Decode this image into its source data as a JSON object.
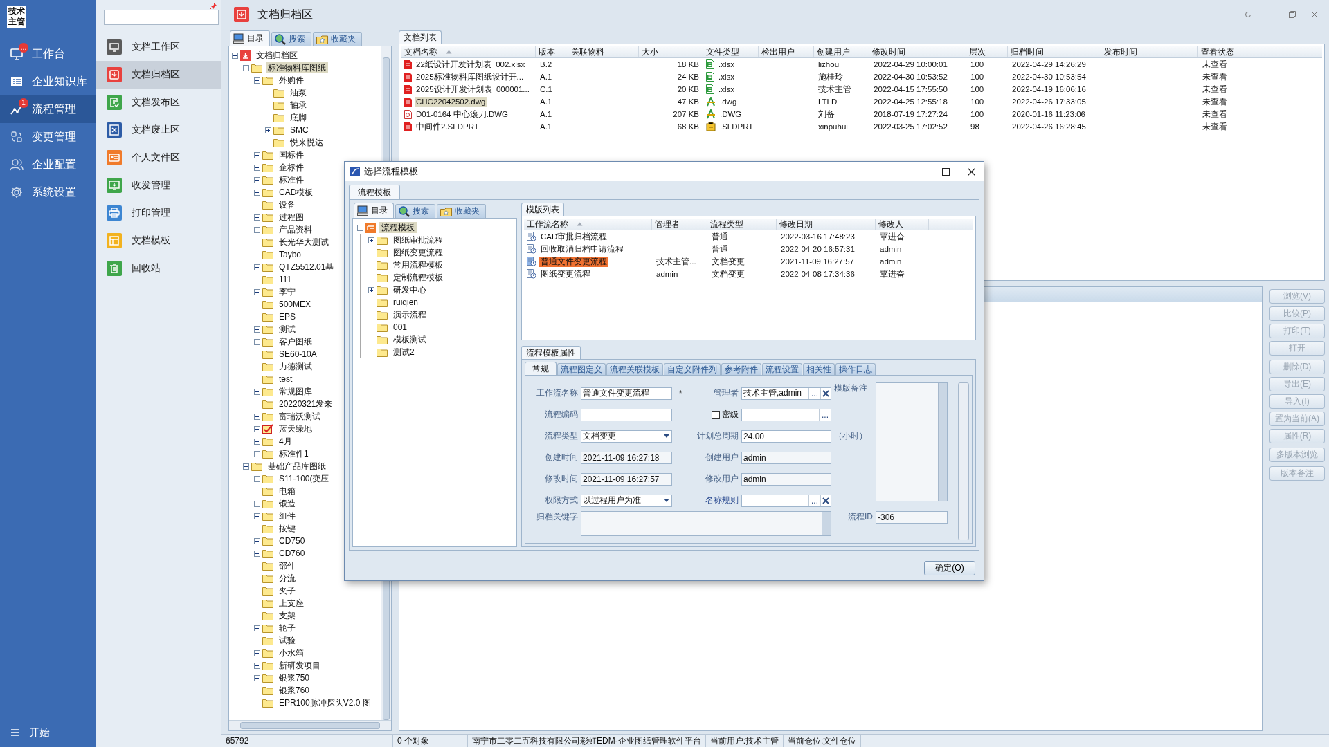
{
  "nav": {
    "logo": "技术主管",
    "items": [
      {
        "label": "工作台",
        "kind": "monitor",
        "badge": "...",
        "selected": false
      },
      {
        "label": "企业知识库",
        "kind": "book",
        "selected": false
      },
      {
        "label": "流程管理",
        "kind": "chart",
        "badge": "1",
        "selected": true
      },
      {
        "label": "变更管理",
        "kind": "swap",
        "selected": false
      },
      {
        "label": "企业配置",
        "kind": "users",
        "selected": false
      },
      {
        "label": "系统设置",
        "kind": "gear",
        "selected": false
      }
    ],
    "start": "开始"
  },
  "sidebar": {
    "items": [
      {
        "label": "文档工作区",
        "kind": "monitor",
        "color": "#5b5b5b",
        "selected": false
      },
      {
        "label": "文档归档区",
        "kind": "archive",
        "color": "#e8413e",
        "selected": true
      },
      {
        "label": "文档发布区",
        "kind": "publish",
        "color": "#3fa64b",
        "selected": false
      },
      {
        "label": "文档废止区",
        "kind": "void",
        "color": "#2d5ca6",
        "selected": false
      },
      {
        "label": "个人文件区",
        "kind": "person",
        "color": "#f07b2b",
        "selected": false
      },
      {
        "label": "收发管理",
        "kind": "inbox",
        "color": "#3fa64b",
        "selected": false
      },
      {
        "label": "打印管理",
        "kind": "print",
        "color": "#3d86d2",
        "selected": false
      },
      {
        "label": "文档模板",
        "kind": "template",
        "color": "#f2b21f",
        "selected": false
      },
      {
        "label": "回收站",
        "kind": "trash",
        "color": "#3fa64b",
        "selected": false
      }
    ]
  },
  "title": "文档归档区",
  "tree_panel": {
    "tabs": [
      {
        "label": "目录",
        "kind": "catalog",
        "selected": true
      },
      {
        "label": "搜索",
        "kind": "search",
        "selected": false
      },
      {
        "label": "收藏夹",
        "kind": "favorites",
        "selected": false
      }
    ],
    "tree": [
      {
        "label": "文档归档区",
        "kind": "archive",
        "selected": false,
        "expanded": true,
        "children": [
          {
            "label": "标准物料库图纸",
            "kind": "folder",
            "selected": true,
            "expanded": true,
            "children": [
              {
                "label": "外购件",
                "kind": "folder",
                "selected": false,
                "expanded": true,
                "children": [
                  {
                    "label": "油泵",
                    "kind": "folder",
                    "selected": false
                  },
                  {
                    "label": "轴承",
                    "kind": "folder",
                    "selected": false
                  },
                  {
                    "label": "底脚",
                    "kind": "folder",
                    "selected": false
                  },
                  {
                    "label": "SMC",
                    "kind": "folder",
                    "selected": false,
                    "expanded": false
                  },
                  {
                    "label": "悦来悦达",
                    "kind": "folder",
                    "selected": false
                  }
                ]
              },
              {
                "label": "国标件",
                "kind": "folder",
                "selected": false,
                "expanded": false
              },
              {
                "label": "企标件",
                "kind": "folder",
                "selected": false,
                "expanded": false
              },
              {
                "label": "标准件",
                "kind": "folder",
                "selected": false,
                "expanded": false
              },
              {
                "label": "CAD模板",
                "kind": "folder",
                "selected": false,
                "expanded": false
              },
              {
                "label": "设备",
                "kind": "folder",
                "selected": false
              },
              {
                "label": "过程图",
                "kind": "folder",
                "selected": false,
                "expanded": false
              },
              {
                "label": "产品资料",
                "kind": "folder",
                "selected": false,
                "expanded": false
              },
              {
                "label": "长光华大测试",
                "kind": "folder",
                "selected": false
              },
              {
                "label": "Taybo",
                "kind": "folder",
                "selected": false
              },
              {
                "label": "QTZ5512.01基",
                "kind": "folder",
                "selected": false,
                "expanded": false
              },
              {
                "label": "111",
                "kind": "folder",
                "selected": false
              },
              {
                "label": "李宁",
                "kind": "folder",
                "selected": false,
                "expanded": false
              },
              {
                "label": "500MEX",
                "kind": "folder",
                "selected": false
              },
              {
                "label": "EPS",
                "kind": "folder",
                "selected": false
              },
              {
                "label": "测试",
                "kind": "folder",
                "selected": false,
                "expanded": false
              },
              {
                "label": "客户图纸",
                "kind": "folder",
                "selected": false,
                "expanded": false
              },
              {
                "label": "SE60-10A",
                "kind": "folder",
                "selected": false
              },
              {
                "label": "力德测试",
                "kind": "folder",
                "selected": false
              },
              {
                "label": "test",
                "kind": "folder",
                "selected": false
              },
              {
                "label": "常规图库",
                "kind": "folder",
                "selected": false,
                "expanded": false
              },
              {
                "label": "20220321发来",
                "kind": "folder",
                "selected": false
              },
              {
                "label": "富瑞沃测试",
                "kind": "folder",
                "selected": false,
                "expanded": false
              },
              {
                "label": "蓝天绿地",
                "kind": "checked",
                "selected": false,
                "expanded": false
              },
              {
                "label": "4月",
                "kind": "folder",
                "selected": false,
                "expanded": false
              },
              {
                "label": "标准件1",
                "kind": "folder",
                "selected": false,
                "expanded": false
              }
            ]
          },
          {
            "label": "基础产品库图纸",
            "kind": "folder",
            "selected": false,
            "expanded": true,
            "children": [
              {
                "label": "S11-100(变压",
                "kind": "folder",
                "selected": false,
                "expanded": false
              },
              {
                "label": "电箱",
                "kind": "folder",
                "selected": false
              },
              {
                "label": "锻造",
                "kind": "folder",
                "selected": false,
                "expanded": false
              },
              {
                "label": "组件",
                "kind": "folder",
                "selected": false,
                "expanded": false
              },
              {
                "label": "按键",
                "kind": "folder",
                "selected": false
              },
              {
                "label": "CD750",
                "kind": "folder",
                "selected": false,
                "expanded": false
              },
              {
                "label": "CD760",
                "kind": "folder",
                "selected": false,
                "expanded": false
              },
              {
                "label": "部件",
                "kind": "folder",
                "selected": false
              },
              {
                "label": "分流",
                "kind": "folder",
                "selected": false
              },
              {
                "label": "夹子",
                "kind": "folder",
                "selected": false
              },
              {
                "label": "上支座",
                "kind": "folder",
                "selected": false
              },
              {
                "label": "支架",
                "kind": "folder",
                "selected": false
              },
              {
                "label": "轮子",
                "kind": "folder",
                "selected": false,
                "expanded": false
              },
              {
                "label": "试验",
                "kind": "folder",
                "selected": false
              },
              {
                "label": "小水箱",
                "kind": "folder",
                "selected": false,
                "expanded": false
              },
              {
                "label": "新研发项目",
                "kind": "folder",
                "selected": false,
                "expanded": false
              },
              {
                "label": "银浆750",
                "kind": "folder",
                "selected": false,
                "expanded": false
              },
              {
                "label": "银浆760",
                "kind": "folder",
                "selected": false
              },
              {
                "label": "EPR100脉冲探头V2.0 图",
                "kind": "folder",
                "selected": false
              }
            ]
          }
        ]
      }
    ]
  },
  "doc_list": {
    "tab": "文档列表",
    "columns": [
      {
        "label": "文档名称",
        "sorted": true
      },
      {
        "label": "版本",
        "sorted": false
      },
      {
        "label": "关联物料",
        "sorted": false
      },
      {
        "label": "大小",
        "sorted": false
      },
      {
        "label": "文件类型",
        "sorted": false
      },
      {
        "label": "检出用户",
        "sorted": false
      },
      {
        "label": "创建用户",
        "sorted": false
      },
      {
        "label": "修改时间",
        "sorted": false
      },
      {
        "label": "层次",
        "sorted": false
      },
      {
        "label": "归档时间",
        "sorted": false
      },
      {
        "label": "发布时间",
        "sorted": false
      },
      {
        "label": "查看状态",
        "sorted": false
      }
    ],
    "rows": [
      {
        "name": "22纸设计开发计划表_002.xlsx",
        "kind": "red",
        "version": "B.2",
        "size": "18 KB",
        "file_type": {
          "text": ".xlsx",
          "kind": "xlsx"
        },
        "creator": "lizhou",
        "modified": "2022-04-29 10:00:01",
        "level": "100",
        "archived": "2022-04-29 14:26:29",
        "view_status": "未查看",
        "selected": false
      },
      {
        "name": "2025标准物料库图纸设计开...",
        "kind": "red",
        "version": "A.1",
        "size": "24 KB",
        "file_type": {
          "text": ".xlsx",
          "kind": "xlsx"
        },
        "creator": "施桂玲",
        "modified": "2022-04-30 10:53:52",
        "level": "100",
        "archived": "2022-04-30 10:53:54",
        "view_status": "未查看",
        "selected": false
      },
      {
        "name": "2025设计开发计划表_000001...",
        "kind": "red",
        "version": "C.1",
        "size": "20 KB",
        "file_type": {
          "text": ".xlsx",
          "kind": "xlsx"
        },
        "creator": "技术主管",
        "modified": "2022-04-15 17:55:50",
        "level": "100",
        "archived": "2022-04-19 16:06:16",
        "view_status": "未查看",
        "selected": false
      },
      {
        "name": "CHC22042502.dwg",
        "kind": "red",
        "version": "A.1",
        "size": "47 KB",
        "file_type": {
          "text": ".dwg",
          "kind": "dwg"
        },
        "creator": "LTLD",
        "modified": "2022-04-25 12:55:18",
        "level": "100",
        "archived": "2022-04-26 17:33:05",
        "view_status": "未查看",
        "selected": true
      },
      {
        "name": "D01-0164 中心滚刀.DWG",
        "kind": "image",
        "version": "A.1",
        "size": "207 KB",
        "file_type": {
          "text": ".DWG",
          "kind": "dwg"
        },
        "creator": "刘备",
        "modified": "2018-07-19 17:27:24",
        "level": "100",
        "archived": "2020-01-16 11:23:06",
        "view_status": "未查看",
        "selected": false
      },
      {
        "name": "中间件2.SLDPRT",
        "kind": "red",
        "version": "A.1",
        "size": "68 KB",
        "file_type": {
          "text": ".SLDPRT",
          "kind": "sldprt"
        },
        "creator": "xinpuhui",
        "modified": "2022-03-25 17:02:52",
        "level": "98",
        "archived": "2022-04-26 16:28:45",
        "view_status": "未查看",
        "selected": false
      }
    ]
  },
  "action_buttons": [
    [
      {
        "label": "浏览(V)",
        "disabled": true
      },
      {
        "label": "比较(P)",
        "disabled": true
      },
      {
        "label": "打印(T)",
        "disabled": true
      },
      {
        "label": "打开",
        "disabled": true
      }
    ],
    [
      {
        "label": "删除(D)",
        "disabled": true
      },
      {
        "label": "导出(E)",
        "disabled": true
      },
      {
        "label": "导入(I)",
        "disabled": true
      },
      {
        "label": "置为当前(A)",
        "disabled": true
      },
      {
        "label": "属性(R)",
        "disabled": true
      }
    ],
    [
      {
        "label": "多版本浏览",
        "disabled": true
      }
    ],
    [
      {
        "label": "版本备注",
        "disabled": true
      }
    ]
  ],
  "status_bar": [
    "65792",
    "0 个对象",
    "南宁市二零二五科技有限公司彩虹EDM-企业图纸管理软件平台",
    "当前用户:技术主管",
    "当前仓位:文件仓位"
  ],
  "dialog": {
    "title": "选择流程模板",
    "tab": "流程模板",
    "tree_tabs": [
      {
        "label": "目录",
        "kind": "catalog",
        "selected": true
      },
      {
        "label": "搜索",
        "kind": "search",
        "selected": false
      },
      {
        "label": "收藏夹",
        "kind": "favorites",
        "selected": false
      }
    ],
    "tree": [
      {
        "label": "流程模板",
        "kind": "template",
        "selected": true,
        "expanded": true,
        "children": [
          {
            "label": "图纸审批流程",
            "kind": "folder",
            "selected": false,
            "expanded": false
          },
          {
            "label": "图纸变更流程",
            "kind": "folder",
            "selected": false
          },
          {
            "label": "常用流程模板",
            "kind": "folder",
            "selected": false
          },
          {
            "label": "定制流程模板",
            "kind": "folder",
            "selected": false
          },
          {
            "label": "研发中心",
            "kind": "folder",
            "selected": false,
            "expanded": false
          },
          {
            "label": "ruiqien",
            "kind": "folder",
            "selected": false
          },
          {
            "label": "演示流程",
            "kind": "folder",
            "selected": false
          },
          {
            "label": "001",
            "kind": "folder",
            "selected": false
          },
          {
            "label": "模板测试",
            "kind": "folder",
            "selected": false
          },
          {
            "label": "测试2",
            "kind": "folder",
            "selected": false
          }
        ]
      }
    ],
    "list_tab": "模版列表",
    "columns": [
      {
        "label": "工作流名称",
        "sorted": true
      },
      {
        "label": "管理者",
        "sorted": false
      },
      {
        "label": "流程类型",
        "sorted": false
      },
      {
        "label": "修改日期",
        "sorted": false
      },
      {
        "label": "修改人",
        "sorted": false
      }
    ],
    "rows": [
      {
        "name": "CAD审批归档流程",
        "type": "普通",
        "modified": "2022-03-16 17:48:23",
        "modifier": "覃进奋",
        "selected": false
      },
      {
        "name": "回收取消归档申请流程",
        "type": "普通",
        "modified": "2022-04-20 16:57:31",
        "modifier": "admin",
        "selected": false
      },
      {
        "name": "普通文件变更流程",
        "manager": "技术主管...",
        "type": "文档变更",
        "modified": "2021-11-09 16:27:57",
        "modifier": "admin",
        "selected": true
      },
      {
        "name": "图纸变更流程",
        "manager": "admin",
        "type": "文档变更",
        "modified": "2022-04-08 17:34:36",
        "modifier": "覃进奋",
        "selected": false
      }
    ],
    "props_tab": "流程模板属性",
    "prop_tabs": [
      {
        "label": "常规",
        "selected": true
      },
      {
        "label": "流程图定义",
        "selected": false
      },
      {
        "label": "流程关联模板",
        "selected": false
      },
      {
        "label": "自定义附件列",
        "selected": false
      },
      {
        "label": "参考附件",
        "selected": false
      },
      {
        "label": "流程设置",
        "selected": false
      },
      {
        "label": "相关性",
        "selected": false
      },
      {
        "label": "操作日志",
        "selected": false
      }
    ],
    "form": {
      "workflow_name": {
        "label": "工作流名称",
        "value": "普通文件变更流程",
        "required_mark": "*"
      },
      "manager": {
        "label": "管理者",
        "value": "技术主管,admin",
        "browse": "..."
      },
      "notes": {
        "label": "模版备注"
      },
      "code": {
        "label": "流程编码"
      },
      "secret": {
        "label": "密级",
        "checked": false,
        "browse": "..."
      },
      "type": {
        "label": "流程类型",
        "value": "文档变更"
      },
      "period": {
        "label": "计划总周期",
        "value": "24.00",
        "unit": "（小时）"
      },
      "created_time": {
        "label": "创建时间",
        "value": "2021-11-09 16:27:18"
      },
      "created_user": {
        "label": "创建用户",
        "value": "admin"
      },
      "modified_time": {
        "label": "修改时间",
        "value": "2021-11-09 16:27:57"
      },
      "modified_user": {
        "label": "修改用户",
        "value": "admin"
      },
      "permission": {
        "label": "权限方式",
        "value": "以过程用户为准"
      },
      "name_rule": {
        "label": "名称规则",
        "browse": "..."
      },
      "keywords": {
        "label": "归档关键字"
      },
      "flow_id": {
        "label": "流程ID",
        "value": "-306"
      }
    },
    "ok_button": "确定(O)"
  }
}
